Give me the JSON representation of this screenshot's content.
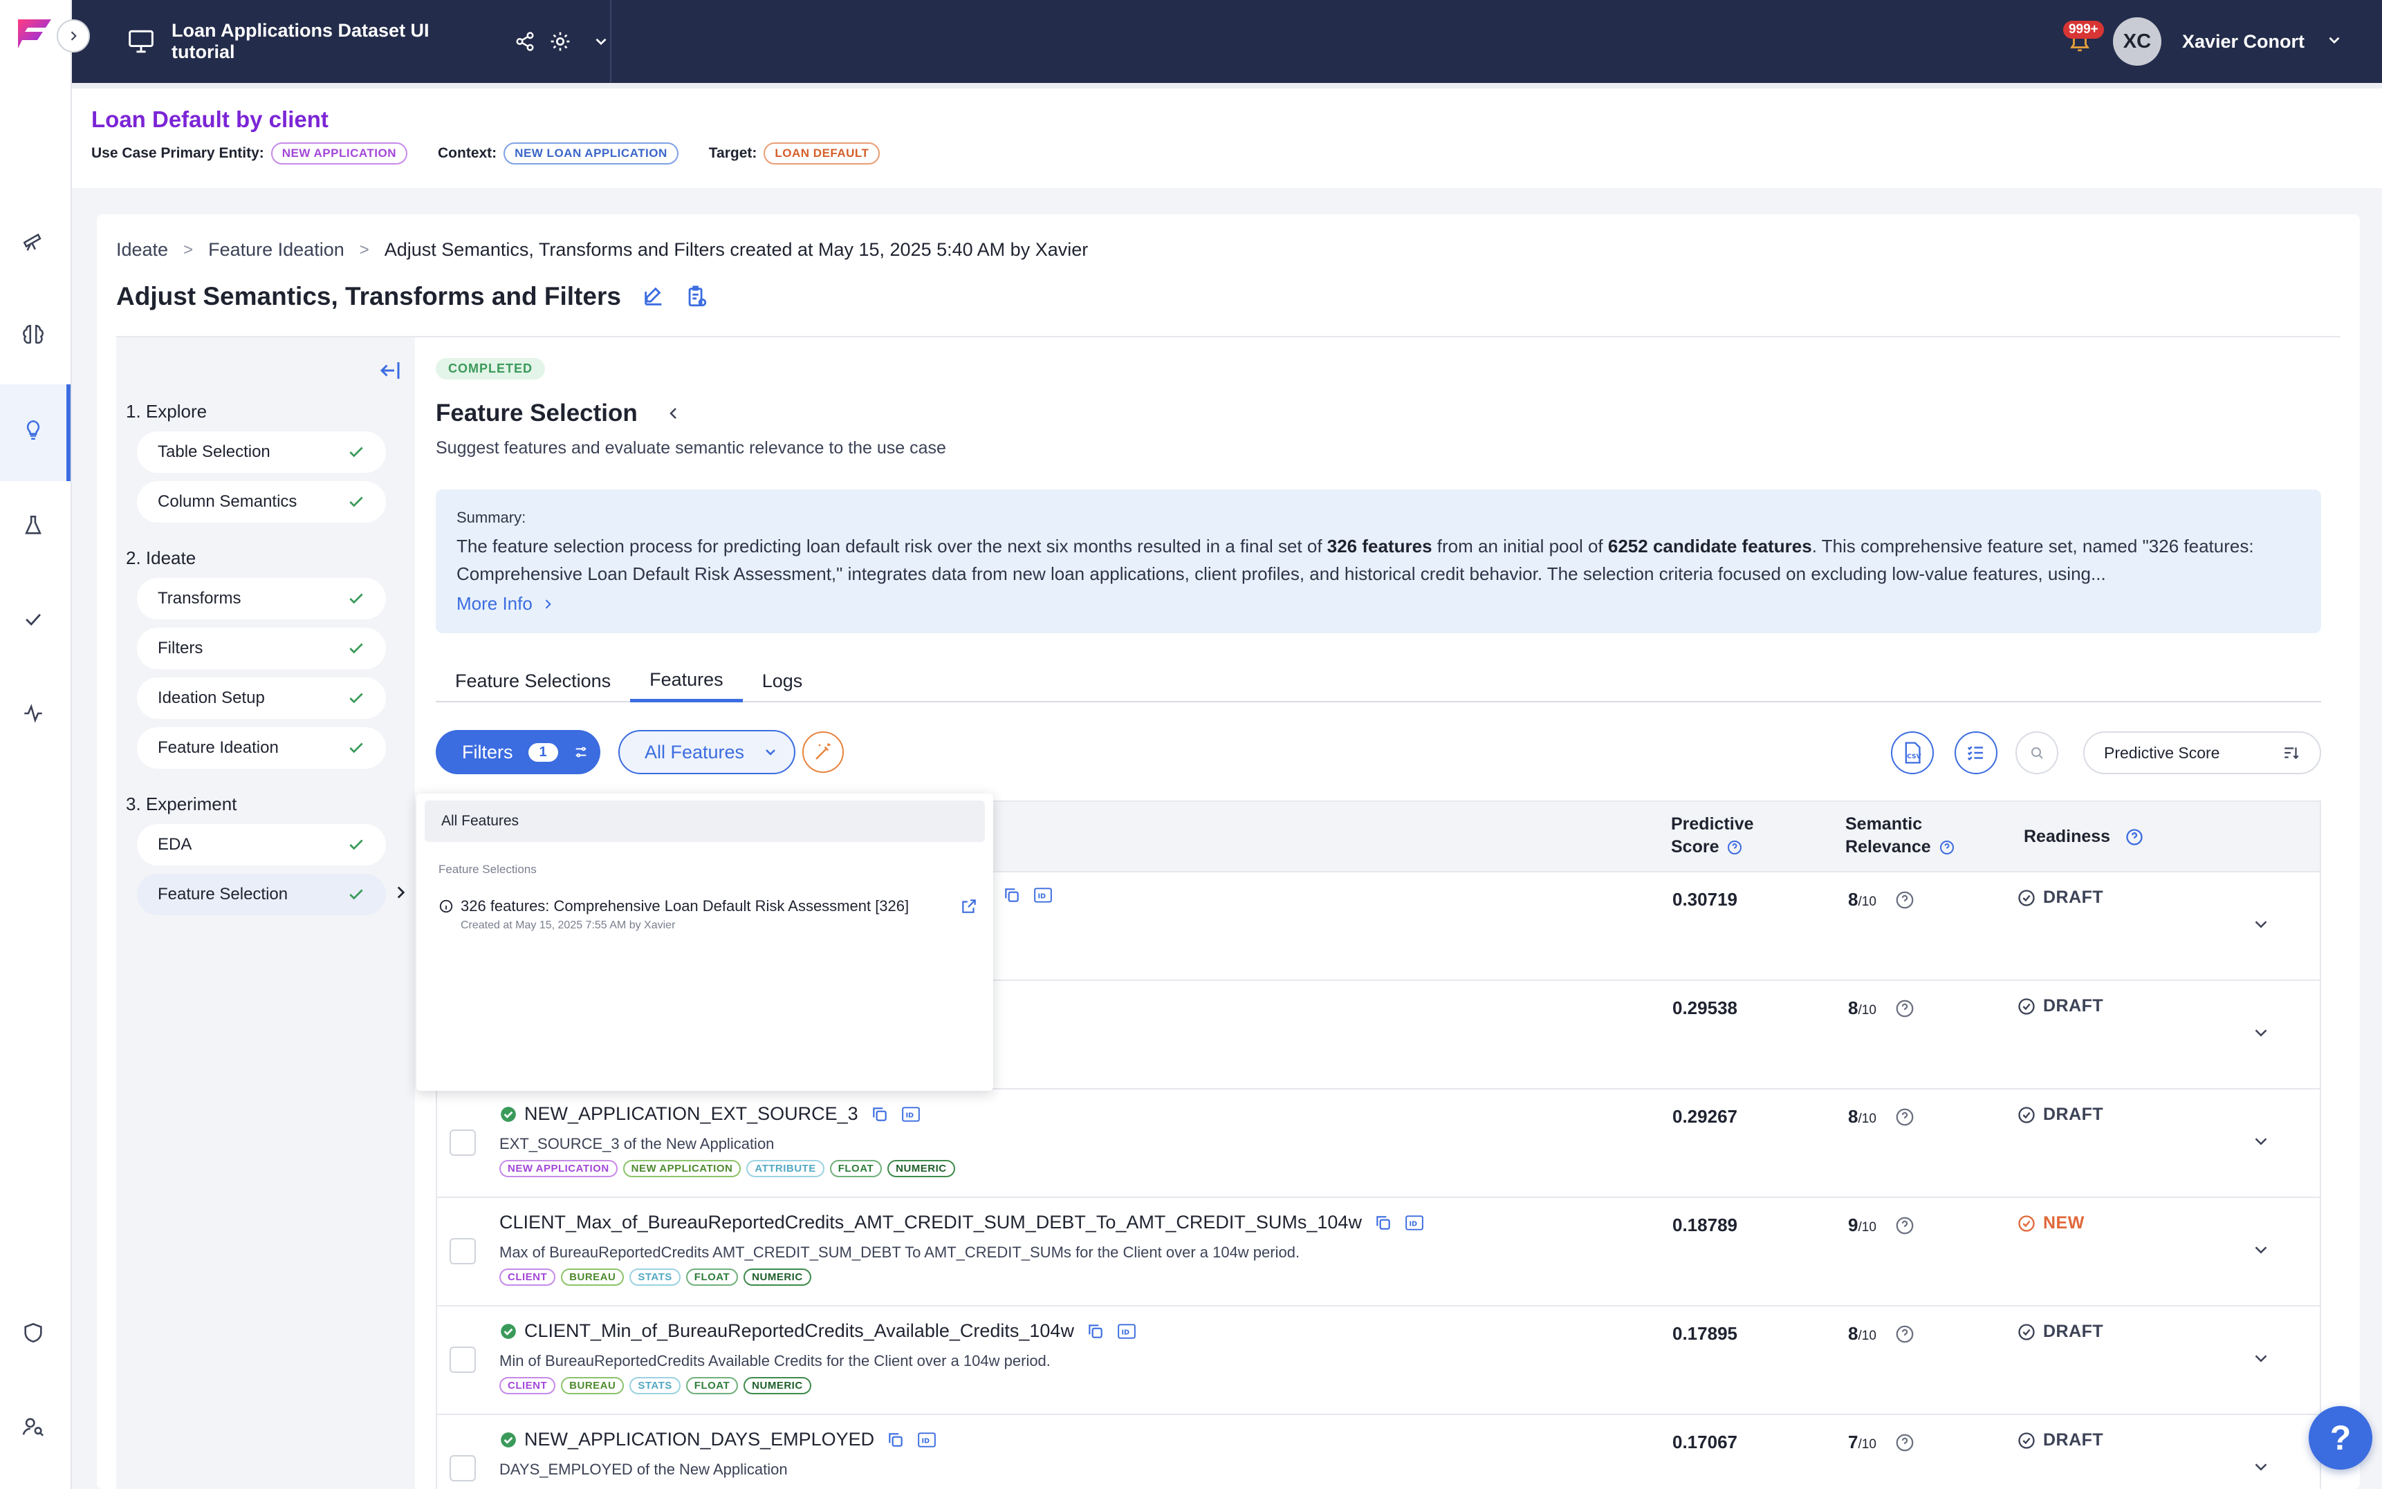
{
  "topbar": {
    "project_title": "Loan Applications Dataset UI tutorial",
    "notifications_badge": "999+",
    "user_initials": "XC",
    "user_name": "Xavier Conort"
  },
  "use_case": {
    "title": "Loan Default by client",
    "primary_entity_label": "Use Case Primary Entity:",
    "primary_entity": "NEW APPLICATION",
    "context_label": "Context:",
    "context": "NEW LOAN APPLICATION",
    "target_label": "Target:",
    "target": "LOAN DEFAULT"
  },
  "breadcrumb": [
    "Ideate",
    "Feature Ideation",
    "Adjust Semantics, Transforms and Filters created at May 15, 2025 5:40 AM by Xavier"
  ],
  "page_title": "Adjust Semantics, Transforms and Filters",
  "steps": {
    "explore": "1. Explore",
    "ideate": "2. Ideate",
    "experiment": "3. Experiment",
    "items": [
      {
        "label": "Table Selection"
      },
      {
        "label": "Column Semantics"
      },
      {
        "label": "Transforms"
      },
      {
        "label": "Filters"
      },
      {
        "label": "Ideation Setup"
      },
      {
        "label": "Feature Ideation"
      },
      {
        "label": "EDA"
      },
      {
        "label": "Feature Selection"
      }
    ]
  },
  "panel": {
    "status": "COMPLETED",
    "title": "Feature Selection",
    "subtitle": "Suggest features and evaluate semantic relevance to the use case",
    "summary_label": "Summary:",
    "summary_p1": "The feature selection process for predicting loan default risk over the next six months resulted in a final set of ",
    "summary_b1": "326 features",
    "summary_p2": " from an initial pool of ",
    "summary_b2": "6252 candidate features",
    "summary_p3": ". This comprehensive feature set, named \"326 features: Comprehensive Loan Default Risk Assessment,\" integrates data from new loan applications, client profiles, and historical credit behavior. The selection criteria focused on excluding low-value features, using...",
    "more_info": "More Info"
  },
  "tabs": [
    "Feature Selections",
    "Features",
    "Logs"
  ],
  "toolbar": {
    "filters_label": "Filters",
    "filters_count": "1",
    "all_features": "All Features",
    "sort_by": "Predictive Score"
  },
  "table": {
    "col_score": [
      "Predictive",
      "Score"
    ],
    "col_relevance": [
      "Semantic",
      "Relevance"
    ],
    "col_readiness": "Readiness",
    "rows": [
      {
        "name": "",
        "desc": "",
        "score": "0.30719",
        "rel": "8",
        "den": "/10",
        "status": "DRAFT",
        "tags": []
      },
      {
        "name": "",
        "desc": "",
        "score": "0.29538",
        "rel": "8",
        "den": "/10",
        "status": "DRAFT",
        "tags": []
      },
      {
        "name": "NEW_APPLICATION_EXT_SOURCE_3",
        "desc": "EXT_SOURCE_3 of the New Application",
        "score": "0.29267",
        "rel": "8",
        "den": "/10",
        "status": "DRAFT",
        "tags": [
          "NEW APPLICATION",
          "NEW APPLICATION",
          "ATTRIBUTE",
          "FLOAT",
          "NUMERIC"
        ]
      },
      {
        "name": "CLIENT_Max_of_BureauReportedCredits_AMT_CREDIT_SUM_DEBT_To_AMT_CREDIT_SUMs_104w",
        "desc": "Max of BureauReportedCredits AMT_CREDIT_SUM_DEBT To AMT_CREDIT_SUMs for the Client over a 104w period.",
        "score": "0.18789",
        "rel": "9",
        "den": "/10",
        "status": "NEW",
        "tags": [
          "CLIENT",
          "BUREAU",
          "STATS",
          "FLOAT",
          "NUMERIC"
        ]
      },
      {
        "name": "CLIENT_Min_of_BureauReportedCredits_Available_Credits_104w",
        "desc": "Min of BureauReportedCredits Available Credits for the Client over a 104w period.",
        "score": "0.17895",
        "rel": "8",
        "den": "/10",
        "status": "DRAFT",
        "tags": [
          "CLIENT",
          "BUREAU",
          "STATS",
          "FLOAT",
          "NUMERIC"
        ]
      },
      {
        "name": "NEW_APPLICATION_DAYS_EMPLOYED",
        "desc": "DAYS_EMPLOYED of the New Application",
        "score": "0.17067",
        "rel": "7",
        "den": "/10",
        "status": "DRAFT",
        "tags": []
      }
    ]
  },
  "dropdown": {
    "all": "All Features",
    "section": "Feature Selections",
    "item_title": "326 features: Comprehensive Loan Default Risk Assessment [326]",
    "item_sub": "Created at May 15, 2025 7:55 AM by Xavier"
  },
  "help": "?",
  "colors": {
    "accent": "#3b6ce0",
    "topbar": "#232c4a",
    "brand_purple": "#7b25d6",
    "new_status": "#e0683a"
  }
}
